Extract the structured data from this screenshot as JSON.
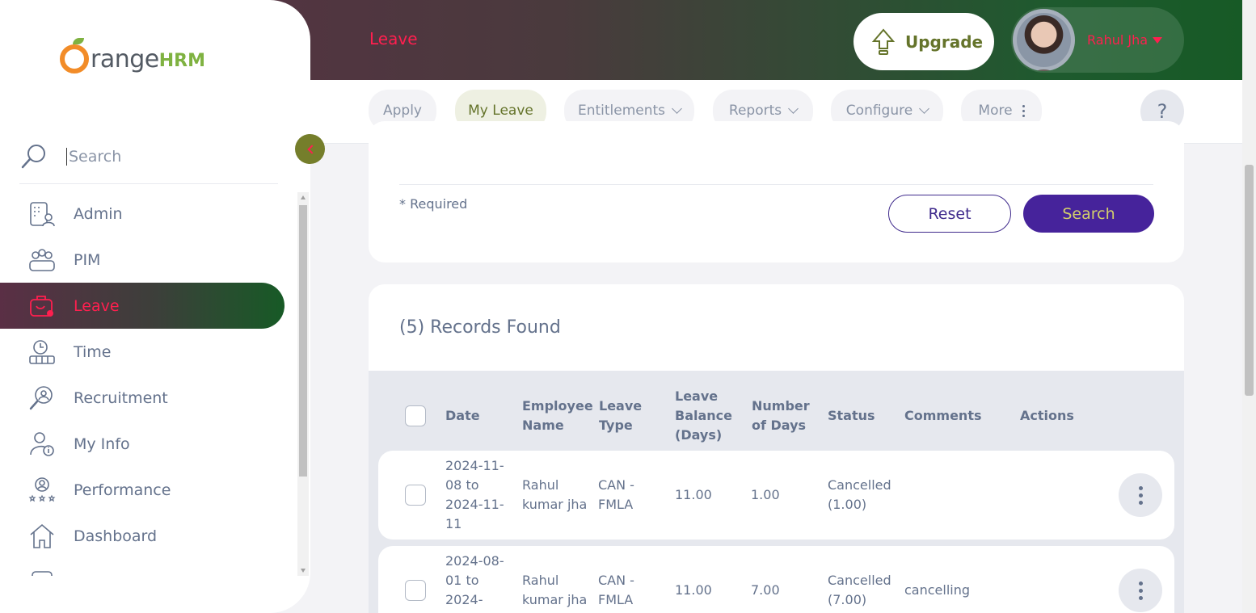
{
  "header": {
    "module_title": "Leave",
    "upgrade_label": "Upgrade",
    "user_name": "Rahul Jha",
    "accent_color": "#ff1f4f",
    "brand_green": "#65742b"
  },
  "subnav": {
    "tabs": [
      {
        "label": "Apply",
        "active": false
      },
      {
        "label": "My Leave",
        "active": true
      },
      {
        "label": "Entitlements",
        "dropdown": true
      },
      {
        "label": "Reports",
        "dropdown": true
      },
      {
        "label": "Configure",
        "dropdown": true
      },
      {
        "label": "More",
        "menu": true
      }
    ],
    "help_label": "?"
  },
  "filter": {
    "required_note": "* Required",
    "reset_label": "Reset",
    "search_label": "Search"
  },
  "records": {
    "found_label": "(5) Records Found",
    "columns": [
      "Date",
      "Employee Name",
      "Leave Type",
      "Leave Balance (Days)",
      "Number of Days",
      "Status",
      "Comments",
      "Actions"
    ],
    "rows": [
      {
        "date": "2024-11-08 to 2024-11-11",
        "employee": "Rahul kumar jha",
        "leave_type": "CAN - FMLA",
        "balance": "11.00",
        "days": "1.00",
        "status": "Cancelled (1.00)",
        "comments": ""
      },
      {
        "date": "2024-08-01 to 2024-",
        "employee": "Rahul kumar jha",
        "leave_type": "CAN - FMLA",
        "balance": "11.00",
        "days": "7.00",
        "status": "Cancelled (7.00)",
        "comments": "cancelling"
      }
    ]
  },
  "sidebar": {
    "logo_text": "range",
    "logo_suffix": "HRM",
    "search_placeholder": "Search",
    "items": [
      {
        "label": "Admin",
        "icon": "admin-icon"
      },
      {
        "label": "PIM",
        "icon": "pim-icon"
      },
      {
        "label": "Leave",
        "icon": "leave-icon",
        "active": true
      },
      {
        "label": "Time",
        "icon": "time-icon"
      },
      {
        "label": "Recruitment",
        "icon": "recruitment-icon"
      },
      {
        "label": "My Info",
        "icon": "my-info-icon"
      },
      {
        "label": "Performance",
        "icon": "performance-icon"
      },
      {
        "label": "Dashboard",
        "icon": "dashboard-icon"
      }
    ]
  }
}
